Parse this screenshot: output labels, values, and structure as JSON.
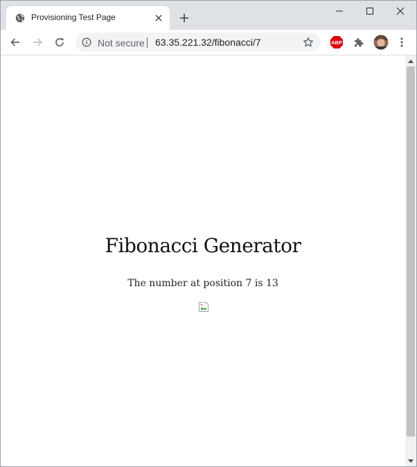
{
  "browser": {
    "tab": {
      "title": "Provisioning Test Page",
      "favicon": "globe-icon"
    },
    "omnibox": {
      "security_label": "Not secure",
      "url": "63.35.221.32/fibonacci/7"
    },
    "extensions": [
      {
        "name": "adblock-plus-icon",
        "label": "ABP",
        "color": "#d9030b"
      },
      {
        "name": "puzzle-piece-icon"
      }
    ],
    "accent_colors": {
      "tabstrip": "#dee1e6",
      "omnibox": "#f1f3f4"
    }
  },
  "page": {
    "heading": "Fibonacci Generator",
    "result": "The number at position 7 is 13",
    "image": "broken-image-icon"
  }
}
